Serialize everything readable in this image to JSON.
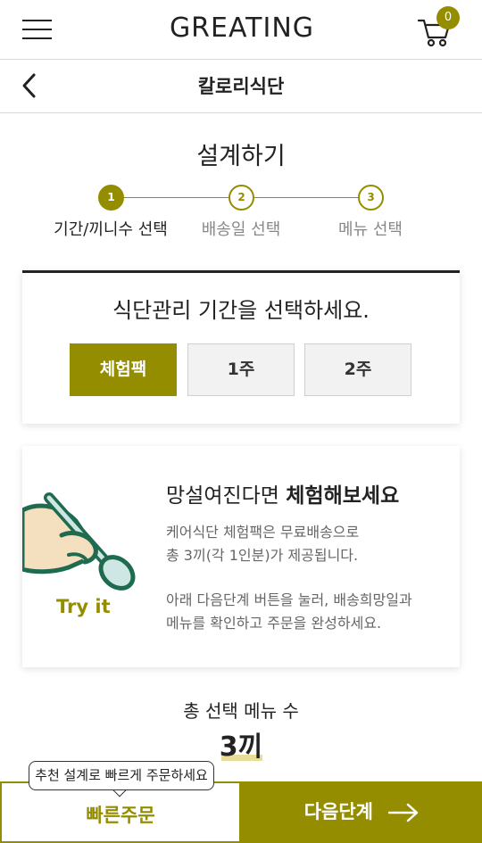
{
  "header": {
    "logo": "GREATING",
    "cart_count": "0"
  },
  "subheader": {
    "title": "칼로리식단"
  },
  "design": {
    "title": "설계하기",
    "steps": [
      {
        "number": "1",
        "label": "기간/끼니수 선택",
        "active": true
      },
      {
        "number": "2",
        "label": "배송일 선택",
        "active": false
      },
      {
        "number": "3",
        "label": "메뉴 선택",
        "active": false
      }
    ]
  },
  "period": {
    "title": "식단관리 기간을 선택하세요.",
    "options": [
      {
        "label": "체험팩",
        "selected": true
      },
      {
        "label": "1주",
        "selected": false
      },
      {
        "label": "2주",
        "selected": false
      }
    ]
  },
  "trial": {
    "illustration_text": "Try it",
    "headline_normal": "망설여진다면 ",
    "headline_bold": "체험해보세요",
    "body_line1": "케어식단 체험팩은 무료배송으로",
    "body_line2": "총 3끼(각 1인분)가 제공됩니다.",
    "body_line3": "아래 다음단계 버튼을 눌러, 배송희망일과",
    "body_line4": "메뉴를 확인하고 주문을 완성하세요."
  },
  "summary": {
    "label": "총 선택 메뉴 수",
    "value": "3끼"
  },
  "footer": {
    "tooltip": "추천 설계로 빠르게 주문하세요",
    "quick_order": "빠른주문",
    "next_step": "다음단계"
  },
  "colors": {
    "accent": "#948d00",
    "highlight": "#e9dd9a",
    "illustration_green": "#1f6b4f",
    "hand": "#f4dfbe"
  },
  "icons": {
    "menu": "hamburger-icon",
    "cart": "cart-icon",
    "back": "chevron-left-icon",
    "next": "arrow-right-icon"
  }
}
